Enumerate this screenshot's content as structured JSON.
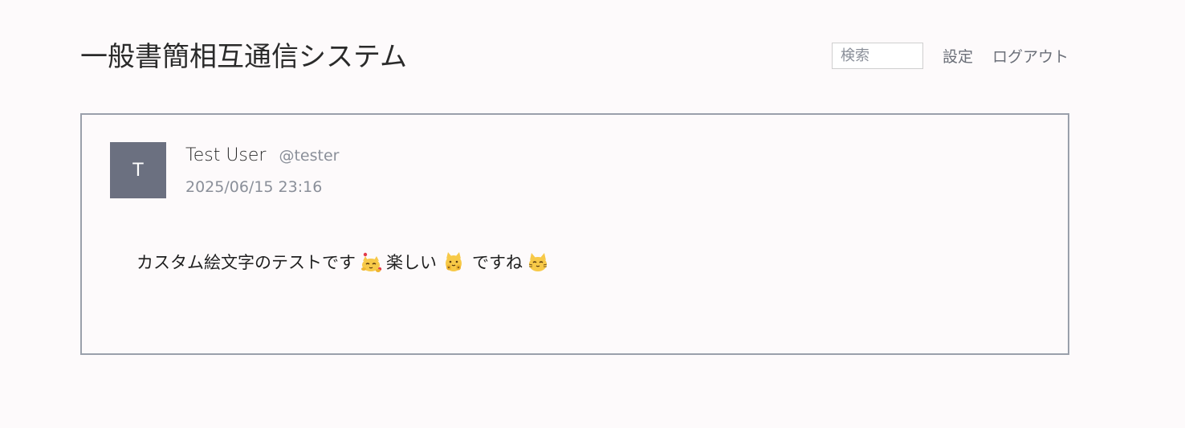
{
  "header": {
    "title": "一般書簡相互通信システム",
    "search_placeholder": "検索",
    "settings_label": "設定",
    "logout_label": "ログアウト"
  },
  "post": {
    "avatar_initial": "T",
    "display_name": "Test User",
    "handle": "@tester",
    "timestamp": "2025/06/15 23:16",
    "body": {
      "text_1": "カスタム絵文字のテストです",
      "emoji_1": "hugging-cat-emoji",
      "text_2": "楽しい",
      "emoji_2": "cheering-cat-emoji",
      "text_3": "ですね",
      "emoji_3": "happy-cat-emoji"
    }
  },
  "colors": {
    "background": "#fdfafb",
    "card_border": "#9aa0ab",
    "avatar_bg": "#6b7080",
    "muted_text": "#8a8f99",
    "emoji_yellow": "#f7c948"
  }
}
